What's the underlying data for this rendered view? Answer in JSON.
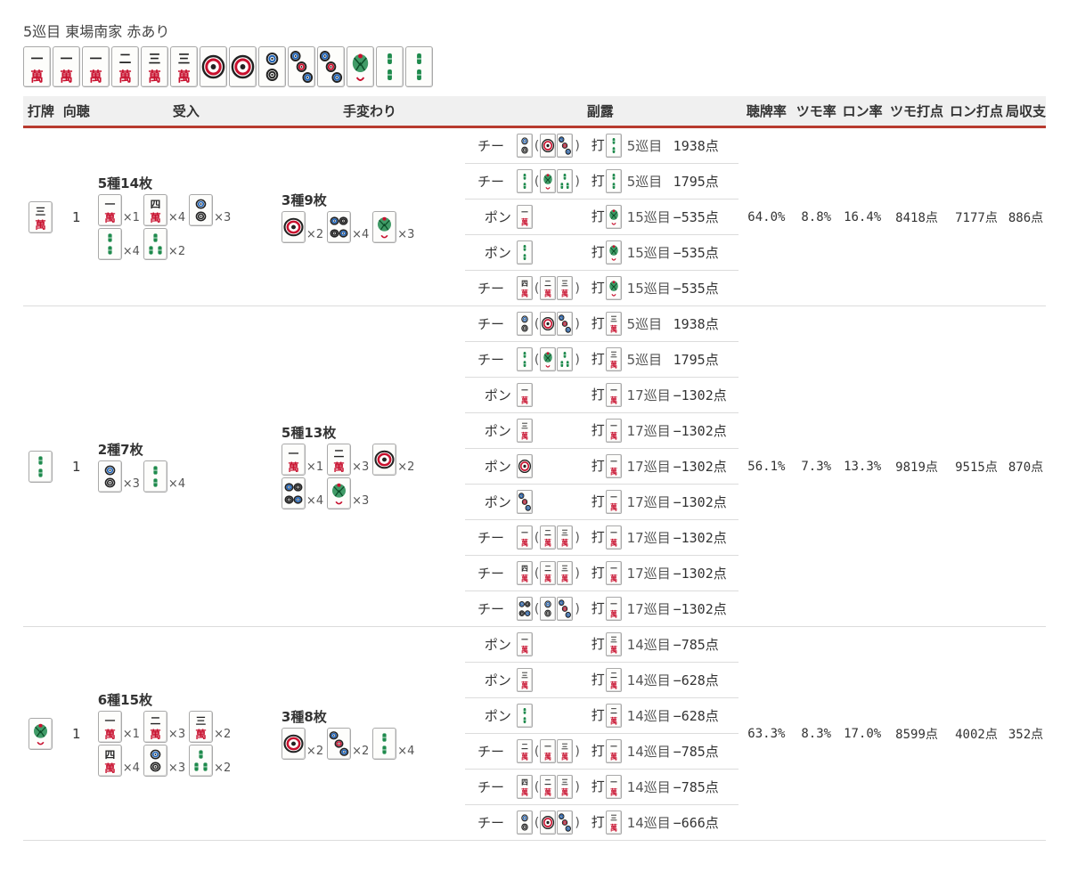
{
  "situation": "5巡目 東場南家 赤あり",
  "hand": [
    "m1",
    "m1",
    "m1",
    "m2",
    "m3",
    "m3",
    "p1",
    "p1",
    "p2",
    "p3",
    "p3",
    "s1",
    "s2",
    "s2"
  ],
  "headers": {
    "discard": "打牌",
    "shanten": "向聴",
    "ukeire": "受入",
    "change": "手変わり",
    "furo": "副露",
    "tenpai": "聴牌率",
    "tsumo": "ツモ率",
    "ron": "ロン率",
    "tsumo_pts": "ツモ打点",
    "ron_pts": "ロン打点",
    "balance": "局収支"
  },
  "rows": [
    {
      "discard": "m3",
      "shanten": "1",
      "ukeire_title": "5種14枚",
      "ukeire": [
        {
          "t": "m1",
          "c": "×1"
        },
        {
          "t": "m4",
          "c": "×4"
        },
        {
          "t": "p2",
          "c": "×3"
        },
        {
          "t": "s2",
          "c": "×4"
        },
        {
          "t": "s3",
          "c": "×2"
        }
      ],
      "change_title": "3種9枚",
      "change": [
        {
          "t": "p1",
          "c": "×2"
        },
        {
          "t": "p4",
          "c": "×4"
        },
        {
          "t": "s1",
          "c": "×3"
        }
      ],
      "furo": [
        {
          "type": "チー",
          "call": "p2",
          "set": [
            "p1",
            "p3"
          ],
          "da": "打",
          "dt": "s2",
          "j": "5巡目",
          "p": "1938点"
        },
        {
          "type": "チー",
          "call": "s2",
          "set": [
            "s1",
            "s3"
          ],
          "da": "打",
          "dt": "s2",
          "j": "5巡目",
          "p": "1795点"
        },
        {
          "type": "ポン",
          "call": "m1",
          "set": [],
          "da": "打",
          "dt": "s1",
          "j": "15巡目",
          "p": "−535点"
        },
        {
          "type": "ポン",
          "call": "s2",
          "set": [],
          "da": "打",
          "dt": "s1",
          "j": "15巡目",
          "p": "−535点"
        },
        {
          "type": "チー",
          "call": "m4",
          "set": [
            "m2",
            "m3"
          ],
          "da": "打",
          "dt": "s1",
          "j": "15巡目",
          "p": "−535点"
        }
      ],
      "tenpai": "64.0%",
      "tsumo": "8.8%",
      "ron": "16.4%",
      "tsumo_pts": "8418点",
      "ron_pts": "7177点",
      "balance": "886点"
    },
    {
      "discard": "s2",
      "shanten": "1",
      "ukeire_title": "2種7枚",
      "ukeire": [
        {
          "t": "p2",
          "c": "×3"
        },
        {
          "t": "s2",
          "c": "×4"
        }
      ],
      "change_title": "5種13枚",
      "change": [
        {
          "t": "m1",
          "c": "×1"
        },
        {
          "t": "m2",
          "c": "×3"
        },
        {
          "t": "p1",
          "c": "×2"
        },
        {
          "t": "p4",
          "c": "×4"
        },
        {
          "t": "s1",
          "c": "×3"
        }
      ],
      "furo": [
        {
          "type": "チー",
          "call": "p2",
          "set": [
            "p1",
            "p3"
          ],
          "da": "打",
          "dt": "m3",
          "j": "5巡目",
          "p": "1938点"
        },
        {
          "type": "チー",
          "call": "s2",
          "set": [
            "s1",
            "s3"
          ],
          "da": "打",
          "dt": "m3",
          "j": "5巡目",
          "p": "1795点"
        },
        {
          "type": "ポン",
          "call": "m1",
          "set": [],
          "da": "打",
          "dt": "m1",
          "j": "17巡目",
          "p": "−1302点"
        },
        {
          "type": "ポン",
          "call": "m3",
          "set": [],
          "da": "打",
          "dt": "m1",
          "j": "17巡目",
          "p": "−1302点"
        },
        {
          "type": "ポン",
          "call": "p1",
          "set": [],
          "da": "打",
          "dt": "m1",
          "j": "17巡目",
          "p": "−1302点"
        },
        {
          "type": "ポン",
          "call": "p3",
          "set": [],
          "da": "打",
          "dt": "m1",
          "j": "17巡目",
          "p": "−1302点"
        },
        {
          "type": "チー",
          "call": "m1",
          "set": [
            "m2",
            "m3"
          ],
          "da": "打",
          "dt": "m1",
          "j": "17巡目",
          "p": "−1302点"
        },
        {
          "type": "チー",
          "call": "m4",
          "set": [
            "m2",
            "m3"
          ],
          "da": "打",
          "dt": "m1",
          "j": "17巡目",
          "p": "−1302点"
        },
        {
          "type": "チー",
          "call": "p4",
          "set": [
            "p2",
            "p3"
          ],
          "da": "打",
          "dt": "m1",
          "j": "17巡目",
          "p": "−1302点"
        }
      ],
      "tenpai": "56.1%",
      "tsumo": "7.3%",
      "ron": "13.3%",
      "tsumo_pts": "9819点",
      "ron_pts": "9515点",
      "balance": "870点"
    },
    {
      "discard": "s1",
      "shanten": "1",
      "ukeire_title": "6種15枚",
      "ukeire": [
        {
          "t": "m1",
          "c": "×1"
        },
        {
          "t": "m2",
          "c": "×3"
        },
        {
          "t": "m3",
          "c": "×2"
        },
        {
          "t": "m4",
          "c": "×4"
        },
        {
          "t": "p2",
          "c": "×3"
        },
        {
          "t": "s3",
          "c": "×2"
        }
      ],
      "change_title": "3種8枚",
      "change": [
        {
          "t": "p1",
          "c": "×2"
        },
        {
          "t": "p3",
          "c": "×2"
        },
        {
          "t": "s2",
          "c": "×4"
        }
      ],
      "furo": [
        {
          "type": "ポン",
          "call": "m1",
          "set": [],
          "da": "打",
          "dt": "m3",
          "j": "14巡目",
          "p": "−785点"
        },
        {
          "type": "ポン",
          "call": "m3",
          "set": [],
          "da": "打",
          "dt": "m2",
          "j": "14巡目",
          "p": "−628点"
        },
        {
          "type": "ポン",
          "call": "s2",
          "set": [],
          "da": "打",
          "dt": "m2",
          "j": "14巡目",
          "p": "−628点"
        },
        {
          "type": "チー",
          "call": "m2",
          "set": [
            "m1",
            "m3"
          ],
          "da": "打",
          "dt": "m1",
          "j": "14巡目",
          "p": "−785点"
        },
        {
          "type": "チー",
          "call": "m4",
          "set": [
            "m2",
            "m3"
          ],
          "da": "打",
          "dt": "m1",
          "j": "14巡目",
          "p": "−785点"
        },
        {
          "type": "チー",
          "call": "p2",
          "set": [
            "p1",
            "p3"
          ],
          "da": "打",
          "dt": "m3",
          "j": "14巡目",
          "p": "−666点"
        }
      ],
      "tenpai": "63.3%",
      "tsumo": "8.3%",
      "ron": "17.0%",
      "tsumo_pts": "8599点",
      "ron_pts": "4002点",
      "balance": "352点"
    }
  ],
  "tile_names": {
    "m1": "一萬",
    "m2": "二萬",
    "m3": "三萬",
    "m4": "四萬",
    "p1": "一筒",
    "p2": "二筒",
    "p3": "三筒",
    "p4": "四筒",
    "s1": "一索",
    "s2": "二索",
    "s3": "三索"
  },
  "colors": {
    "accent": "#b83a2f",
    "man_red": "#c8102e",
    "sou_green": "#1e8a4c",
    "header_bg": "#f0f0f0"
  }
}
